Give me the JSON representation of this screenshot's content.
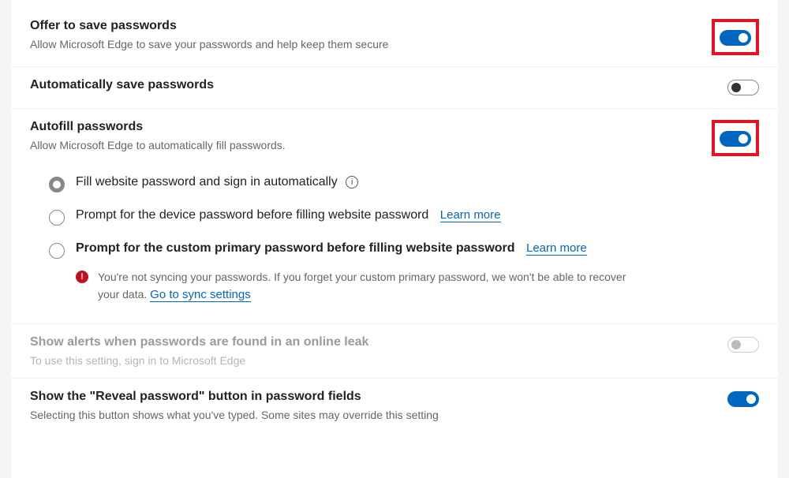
{
  "rows": {
    "offer": {
      "title": "Offer to save passwords",
      "desc": "Allow Microsoft Edge to save your passwords and help keep them secure",
      "on": true
    },
    "auto_save": {
      "title": "Automatically save passwords",
      "on": false
    },
    "autofill": {
      "title": "Autofill passwords",
      "desc": "Allow Microsoft Edge to automatically fill passwords.",
      "on": true
    },
    "alerts": {
      "title": "Show alerts when passwords are found in an online leak",
      "desc": "To use this setting, sign in to Microsoft Edge",
      "on": false
    },
    "reveal": {
      "title": "Show the \"Reveal password\" button in password fields",
      "desc": "Selecting this button shows what you've typed. Some sites may override this setting",
      "on": true
    }
  },
  "options": {
    "opt1": {
      "label": "Fill website password and sign in automatically"
    },
    "opt2": {
      "label": "Prompt for the device password before filling website password",
      "learn_more": "Learn more"
    },
    "opt3": {
      "label": "Prompt for the custom primary password before filling website password",
      "learn_more": "Learn more",
      "warning": "You're not syncing your passwords. If you forget your custom primary password, we won't be able to recover your data. ",
      "sync_link": "Go to sync settings"
    }
  },
  "colors": {
    "accent": "#0067c0",
    "highlight": "#e81123",
    "danger": "#c50f1f"
  }
}
